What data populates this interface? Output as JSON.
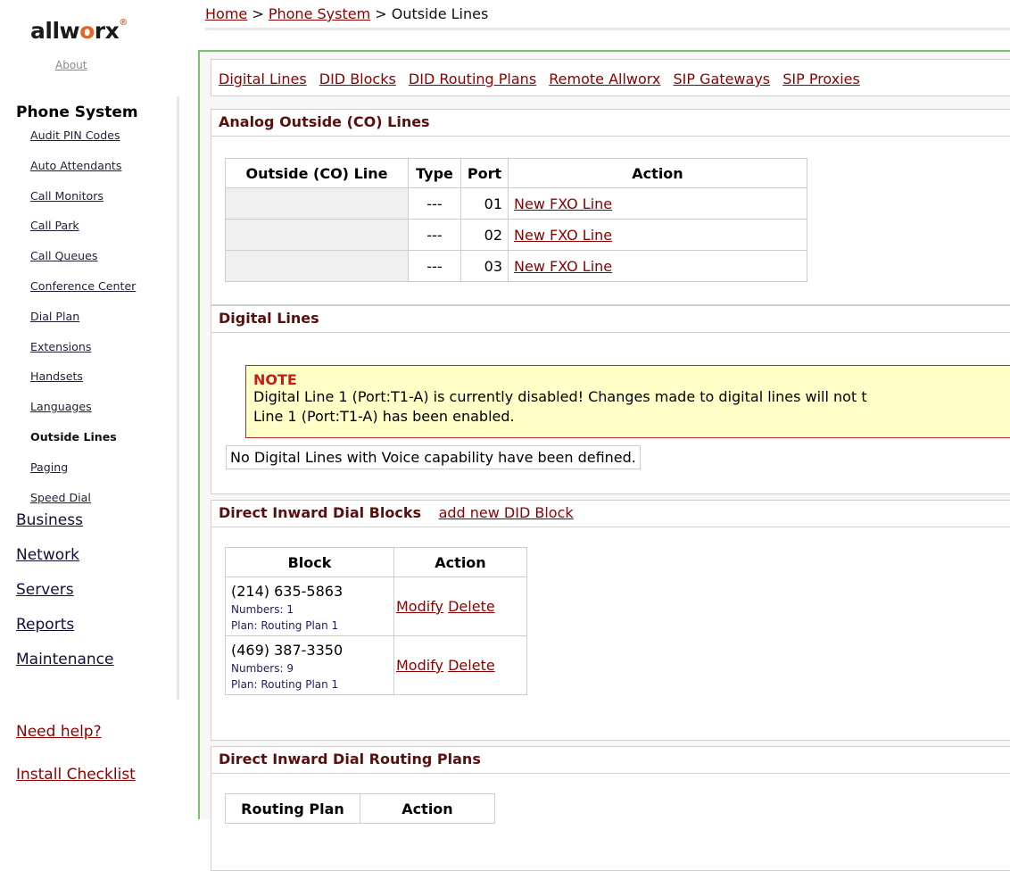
{
  "brand": {
    "logo_text_a": "allw",
    "logo_text_x": "o",
    "logo_text_b": "rx",
    "logo_dot": "®",
    "about": "About"
  },
  "breadcrumb": {
    "home": "Home",
    "sep1": ">",
    "phone": "Phone System",
    "sep2": ">",
    "current": "Outside Lines"
  },
  "sidebar": {
    "section": "Phone System",
    "items": [
      {
        "label": "Audit PIN Codes"
      },
      {
        "label": "Auto Attendants"
      },
      {
        "label": "Call Monitors"
      },
      {
        "label": "Call Park"
      },
      {
        "label": "Call Queues"
      },
      {
        "label": "Conference Center"
      },
      {
        "label": "Dial Plan"
      },
      {
        "label": "Extensions"
      },
      {
        "label": "Handsets"
      },
      {
        "label": "Languages"
      },
      {
        "label": "Outside Lines"
      },
      {
        "label": "Paging"
      },
      {
        "label": "Speed Dial"
      }
    ],
    "top_items": [
      {
        "label": "Business"
      },
      {
        "label": "Network"
      },
      {
        "label": "Servers"
      },
      {
        "label": "Reports"
      },
      {
        "label": "Maintenance"
      }
    ],
    "help": "Need help?",
    "checklist": "Install Checklist"
  },
  "tabs": [
    {
      "label": "Digital Lines"
    },
    {
      "label": "DID Blocks"
    },
    {
      "label": "DID Routing Plans"
    },
    {
      "label": "Remote Allworx"
    },
    {
      "label": "SIP Gateways"
    },
    {
      "label": "SIP Proxies"
    }
  ],
  "analog": {
    "title": "Analog Outside (CO) Lines",
    "headers": [
      "Outside (CO) Line",
      "Type",
      "Port",
      "Action"
    ],
    "rows": [
      {
        "line": "",
        "type": "---",
        "port": "01",
        "action": "New FXO Line"
      },
      {
        "line": "",
        "type": "---",
        "port": "02",
        "action": "New FXO Line"
      },
      {
        "line": "",
        "type": "---",
        "port": "03",
        "action": "New FXO Line"
      }
    ]
  },
  "digital": {
    "title": "Digital Lines",
    "note_label": "NOTE",
    "note_line1": "Digital Line 1 (Port:T1-A) is currently disabled! Changes made to digital lines will not t",
    "note_line2": "Line 1 (Port:T1-A) has been enabled.",
    "empty": "No Digital Lines with Voice capability have been defined."
  },
  "did": {
    "title": "Direct Inward Dial Blocks",
    "add_link": "add new DID Block",
    "headers": [
      "Block",
      "Action"
    ],
    "rows": [
      {
        "block": "(214) 635-5863",
        "numbers": "Numbers: 1",
        "plan": "Plan: Routing Plan 1",
        "modify": "Modify",
        "delete": "Delete"
      },
      {
        "block": "(469) 387-3350",
        "numbers": "Numbers: 9",
        "plan": "Plan: Routing Plan 1",
        "modify": "Modify",
        "delete": "Delete"
      }
    ]
  },
  "routing": {
    "title": "Direct Inward Dial Routing Plans",
    "headers": [
      "Routing Plan",
      "Action"
    ]
  },
  "colors": {
    "link": "#8b0000",
    "panel_title": "#5a0f0f",
    "note_bg": "#ffffc8",
    "accent_green": "#7fbf6b",
    "logo_orange": "#e0662a"
  }
}
